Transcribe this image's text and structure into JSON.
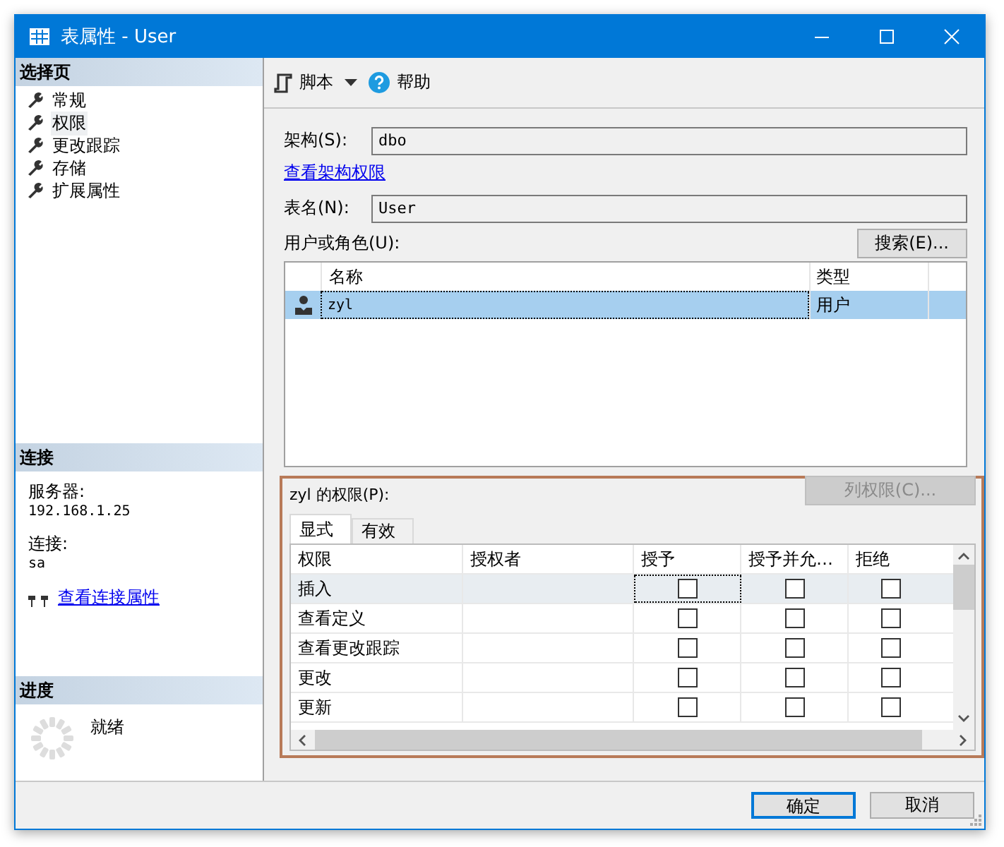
{
  "window": {
    "title": "表属性 - User"
  },
  "sidebar": {
    "header": "选择页",
    "items": [
      {
        "label": "常规",
        "selected": false
      },
      {
        "label": "权限",
        "selected": true
      },
      {
        "label": "更改跟踪",
        "selected": false
      },
      {
        "label": "存储",
        "selected": false
      },
      {
        "label": "扩展属性",
        "selected": false
      }
    ]
  },
  "connection": {
    "header": "连接",
    "server_label": "服务器:",
    "server": "192.168.1.25",
    "conn_label": "连接:",
    "conn": "sa",
    "link": "查看连接属性"
  },
  "progress": {
    "header": "进度",
    "status": "就绪"
  },
  "toolbar": {
    "script": "脚本",
    "help": "帮助"
  },
  "schema": {
    "label": "架构(S):",
    "value": "dbo",
    "link": "查看架构权限"
  },
  "table_name": {
    "label": "表名(N):",
    "value": "User"
  },
  "users": {
    "label": "用户或角色(U):",
    "search_button": "搜索(E)...",
    "columns": [
      "名称",
      "类型"
    ],
    "rows": [
      {
        "name": "zyl",
        "type": "用户",
        "selected": true
      }
    ]
  },
  "permissions": {
    "label": "zyl 的权限(P):",
    "column_button": "列权限(C)...",
    "column_button_disabled": true,
    "tabs": [
      {
        "label": "显式",
        "selected": true
      },
      {
        "label": "有效",
        "selected": false
      }
    ],
    "columns": [
      "权限",
      "授权者",
      "授予",
      "授予并允…",
      "拒绝"
    ],
    "rows": [
      {
        "permission": "插入",
        "selected": true,
        "grant": false,
        "with_grant": false,
        "deny": false
      },
      {
        "permission": "查看定义",
        "selected": false,
        "grant": false,
        "with_grant": false,
        "deny": false
      },
      {
        "permission": "查看更改跟踪",
        "selected": false,
        "grant": false,
        "with_grant": false,
        "deny": false
      },
      {
        "permission": "更改",
        "selected": false,
        "grant": false,
        "with_grant": false,
        "deny": false
      },
      {
        "permission": "更新",
        "selected": false,
        "grant": false,
        "with_grant": false,
        "deny": false
      }
    ]
  },
  "buttons": {
    "ok": "确定",
    "cancel": "取消"
  }
}
